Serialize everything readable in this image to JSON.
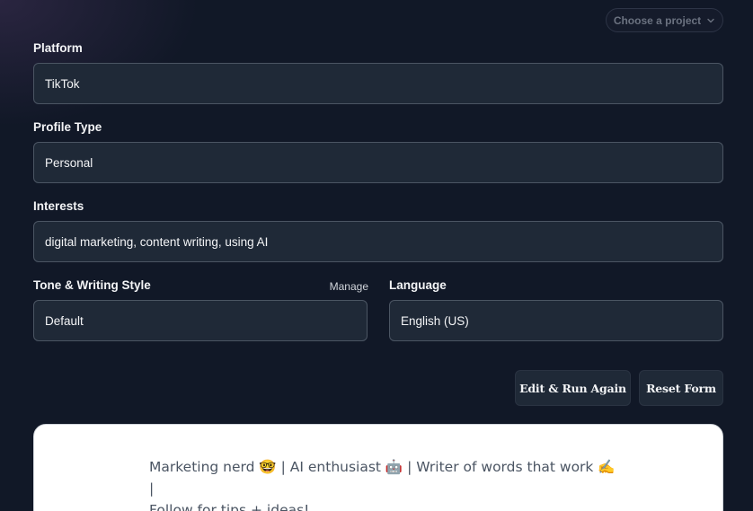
{
  "header": {
    "project_select": "Choose a project",
    "project_select_icon": "chevron-down-icon"
  },
  "form": {
    "platform": {
      "label": "Platform",
      "value": "TikTok"
    },
    "profile_type": {
      "label": "Profile Type",
      "value": "Personal"
    },
    "interests": {
      "label": "Interests",
      "value": "digital marketing, content writing, using AI"
    },
    "tone": {
      "label": "Tone & Writing Style",
      "manage": "Manage",
      "value": "Default"
    },
    "language": {
      "label": "Language",
      "value": "English (US)"
    }
  },
  "actions": {
    "edit_run": "Edit & Run Again",
    "reset": "Reset Form"
  },
  "result": {
    "line1": "Marketing nerd 🤓 | AI enthusiast 🤖 | Writer of words that work ✍️ |",
    "line2": "Follow for tips + ideas!"
  }
}
